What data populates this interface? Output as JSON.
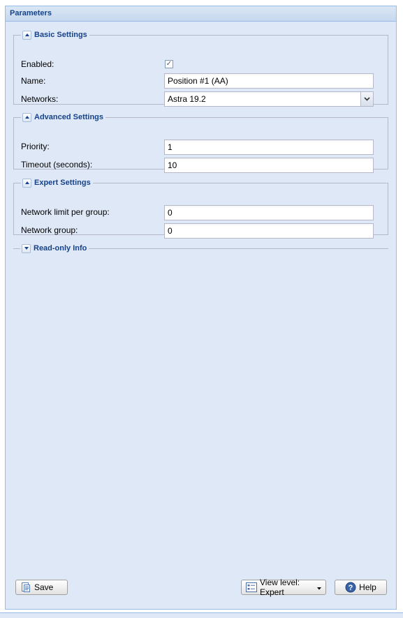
{
  "panel": {
    "title": "Parameters"
  },
  "basic": {
    "title": "Basic Settings",
    "enabled_label": "Enabled:",
    "enabled_checked": true,
    "name_label": "Name:",
    "name_value": "Position #1 (AA)",
    "networks_label": "Networks:",
    "networks_value": "Astra 19.2"
  },
  "advanced": {
    "title": "Advanced Settings",
    "priority_label": "Priority:",
    "priority_value": "1",
    "timeout_label": "Timeout (seconds):",
    "timeout_value": "10"
  },
  "expert": {
    "title": "Expert Settings",
    "limit_label": "Network limit per group:",
    "limit_value": "0",
    "group_label": "Network group:",
    "group_value": "0"
  },
  "readonly": {
    "title": "Read-only Info"
  },
  "toolbar": {
    "save_label": "Save",
    "view_level_label": "View level: Expert",
    "help_label": "Help"
  },
  "colors": {
    "panel_bg": "#dfe8f6",
    "header_text": "#15428b",
    "border": "#99bbe8"
  },
  "icons": {
    "expand": "chevron-up-icon",
    "collapse": "chevron-down-icon",
    "save": "save-icon",
    "view": "view-level-icon",
    "help": "help-icon"
  }
}
